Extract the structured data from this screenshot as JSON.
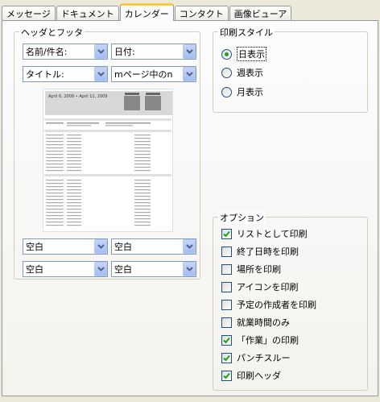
{
  "tabs": [
    {
      "label": "メッセージ",
      "active": false
    },
    {
      "label": "ドキュメント",
      "active": false
    },
    {
      "label": "カレンダー",
      "active": true
    },
    {
      "label": "コンタクト",
      "active": false
    },
    {
      "label": "画像ビューア",
      "active": false
    }
  ],
  "header_footer": {
    "title": "ヘッダとフッタ",
    "header_left": "名前/件名:",
    "header_right": "日付:",
    "header2_left": "タイトル:",
    "header2_right": "mページ中のn",
    "footer_left": "空白",
    "footer_right": "空白",
    "footer2_left": "空白",
    "footer2_right": "空白"
  },
  "preview": {
    "heading": "April 6, 2009  •  April 11, 2009"
  },
  "print_style": {
    "title": "印刷スタイル",
    "options": [
      {
        "label": "日表示",
        "selected": true
      },
      {
        "label": "週表示",
        "selected": false
      },
      {
        "label": "月表示",
        "selected": false
      }
    ]
  },
  "options": {
    "title": "オプション",
    "items": [
      {
        "label": "リストとして印刷",
        "checked": true
      },
      {
        "label": "終了日時を印刷",
        "checked": false
      },
      {
        "label": "場所を印刷",
        "checked": false
      },
      {
        "label": "アイコンを印刷",
        "checked": false
      },
      {
        "label": "予定の作成者を印刷",
        "checked": false
      },
      {
        "label": "就業時間のみ",
        "checked": false
      },
      {
        "label": "「作業」の印刷",
        "checked": true
      },
      {
        "label": "パンチスルー",
        "checked": true
      },
      {
        "label": "印刷ヘッダ",
        "checked": true
      }
    ]
  },
  "colors": {
    "accent_check": "#21A121",
    "tab_highlight": "#FFC83C"
  }
}
